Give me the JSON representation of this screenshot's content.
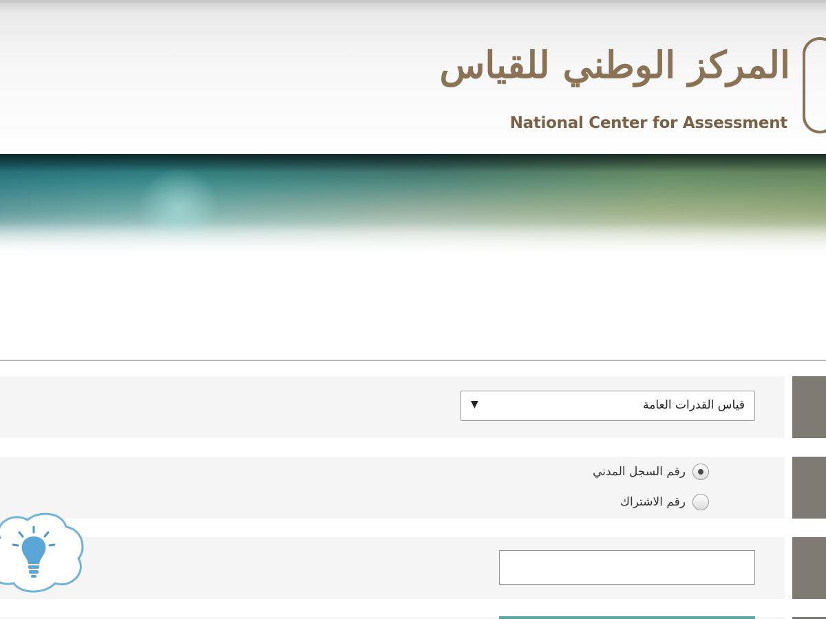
{
  "header": {
    "logo_arabic": "المركز الوطني للقياس",
    "logo_english": "National Center for Assessment"
  },
  "form": {
    "exam_select": {
      "selected": "قياس القدرات العامة",
      "arrow": "▼"
    },
    "id_type": {
      "options": [
        {
          "label": "رقم السجل المدني",
          "checked": true
        },
        {
          "label": "رقم الاشتراك",
          "checked": false
        }
      ]
    },
    "id_input": {
      "value": ""
    }
  },
  "help": {
    "icon": "lightbulb-icon"
  },
  "colors": {
    "brand_gold": "#8a7355",
    "row_background": "#f5f5f5",
    "label_block": "#7f7b74",
    "accent_teal": "#5aa8a0"
  }
}
